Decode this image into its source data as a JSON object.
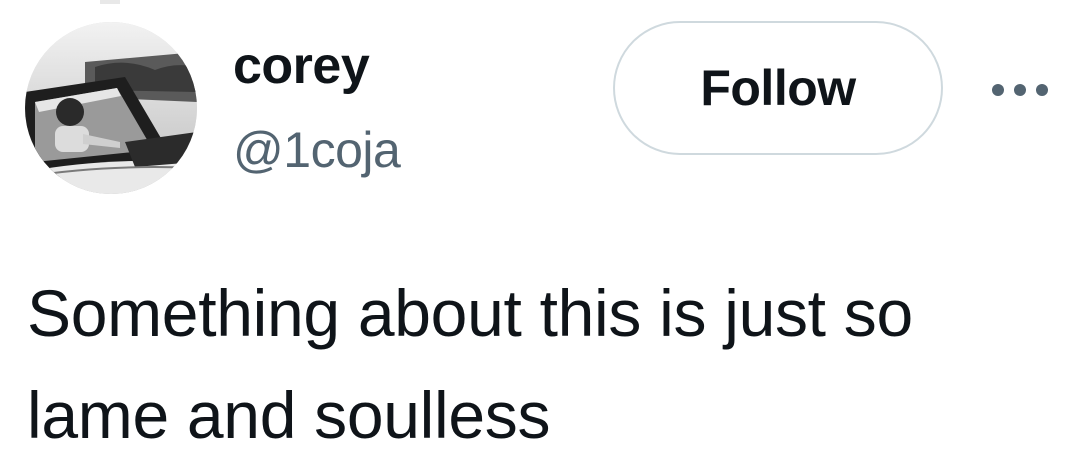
{
  "tweet": {
    "author": {
      "display_name": "corey",
      "handle": "@1coja",
      "avatar": "avatar-photo-bw-car"
    },
    "follow_label": "Follow",
    "more_icon": "more-horizontal-icon",
    "text": "Something about this is just so lame and soulless"
  },
  "colors": {
    "text_primary": "#0f1419",
    "text_secondary": "#536471",
    "button_border": "#cfd9de",
    "background": "#ffffff"
  }
}
